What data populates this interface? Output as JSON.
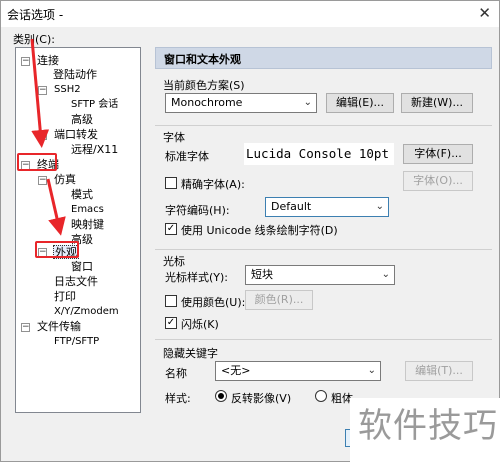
{
  "window": {
    "title": "会话选项 -",
    "close_glyph": "✕"
  },
  "category_label": "类别(C):",
  "tree": {
    "items": [
      {
        "label": "连接",
        "exp": "−"
      },
      {
        "label": "登陆动作"
      },
      {
        "label": "SSH2",
        "exp": "−"
      },
      {
        "label": "SFTP 会话"
      },
      {
        "label": "高级"
      },
      {
        "label": "端口转发",
        "exp": "−"
      },
      {
        "label": "远程/X11"
      },
      {
        "label": "终端",
        "exp": "−"
      },
      {
        "label": "仿真",
        "exp": "−"
      },
      {
        "label": "模式"
      },
      {
        "label": "Emacs"
      },
      {
        "label": "映射键"
      },
      {
        "label": "高级"
      },
      {
        "label": "外观",
        "exp": "−"
      },
      {
        "label": "窗口"
      },
      {
        "label": "日志文件"
      },
      {
        "label": "打印"
      },
      {
        "label": "X/Y/Zmodem"
      },
      {
        "label": "文件传输",
        "exp": "−"
      },
      {
        "label": "FTP/SFTP"
      }
    ]
  },
  "header": {
    "title": "窗口和文本外观"
  },
  "color_scheme": {
    "label": "当前颜色方案(S)",
    "value": "Monochrome",
    "edit_button": "编辑(E)...",
    "new_button": "新建(W)..."
  },
  "font": {
    "group_label": "字体",
    "standard_label": "标准字体",
    "standard_preview": "Lucida Console 10pt",
    "font_button": "字体(F)...",
    "precise_label": "精确字体(A):",
    "precise_button": "字体(O)...",
    "encoding_label": "字符编码(H):",
    "encoding_value": "Default",
    "unicode_label": "使用 Unicode 线条绘制字符(D)",
    "unicode_checked": true
  },
  "cursor": {
    "group_label": "光标",
    "style_label": "光标样式(Y):",
    "style_value": "短块",
    "use_color_label": "使用颜色(U):",
    "color_button": "颜色(R)...",
    "blink_label": "闪烁(K)",
    "blink_checked": true
  },
  "keywords": {
    "group_label": "隐藏关键字",
    "name_label": "名称",
    "name_value": "<无>",
    "edit_button": "编辑(T)...",
    "style_label": "样式:",
    "radio_reverse": "反转影像(V)",
    "radio_bold": "粗体"
  },
  "watermark": "软件技巧",
  "colors": {
    "accent": "#e8262a",
    "header_bg": "#cfd8e6"
  }
}
